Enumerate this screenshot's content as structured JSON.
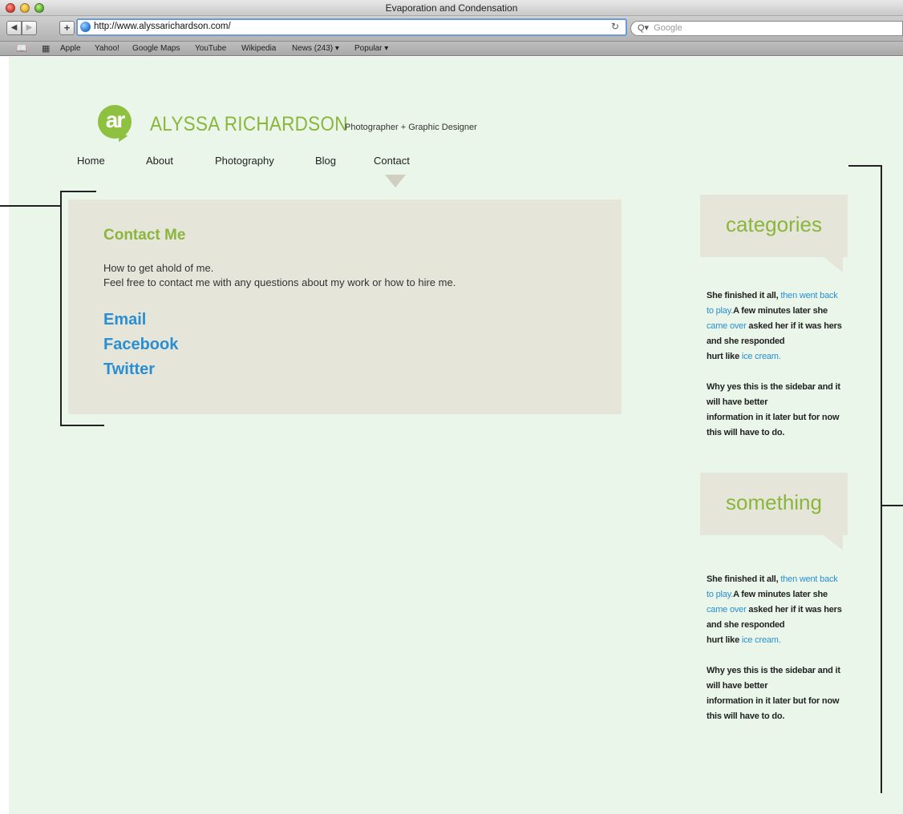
{
  "window": {
    "title": "Evaporation and Condensation"
  },
  "toolbar": {
    "back_icon": "◀",
    "forward_icon": "▶",
    "add_icon": "+",
    "url": "http://www.alyssarichardson.com/",
    "reload_icon": "↻",
    "search_icon": "Q▾",
    "search_placeholder": "Google"
  },
  "bookmarks": {
    "items": [
      "Apple",
      "Yahoo!",
      "Google Maps",
      "YouTube",
      "Wikipedia",
      "News (243) ▾",
      "Popular ▾"
    ]
  },
  "site": {
    "logo_text": "ar",
    "name": "ALYSSA RICHARDSON",
    "tagline": "Photographer + Graphic Designer",
    "nav": [
      "Home",
      "About",
      "Photography",
      "Blog",
      "Contact"
    ],
    "active_nav": "Contact"
  },
  "contact": {
    "title": "Contact Me",
    "line1": "How to get ahold of me.",
    "line2": "Feel free to contact me with any questions about my work or how to hire me.",
    "links": [
      "Email",
      "Facebook",
      "Twitter"
    ]
  },
  "sidebar": {
    "sections": [
      {
        "heading": "categories",
        "p1_a": "She finished it all,",
        "p1_link1": "then went back",
        "p1_b": "to play.",
        "p1_c": "A few minutes later she",
        "p1_link2": "came over",
        "p1_d": "asked her if it was hers",
        "p1_e": "and she responded",
        "p1_f": "hurt like",
        "p1_link3": "ice cream.",
        "p2_1": "Why yes this is the sidebar and it",
        "p2_2": "will have better",
        "p2_3": "information in it later but for now",
        "p2_4": "this will have to do."
      },
      {
        "heading": "something",
        "p1_a": "She finished it all,",
        "p1_link1": "then went back",
        "p1_b": "to play.",
        "p1_c": "A few minutes later she",
        "p1_link2": "came over",
        "p1_d": "asked her if it was hers",
        "p1_e": "and she responded",
        "p1_f": "hurt like",
        "p1_link3": "ice cream.",
        "p2_1": "Why yes this is the sidebar and it",
        "p2_2": "will have better",
        "p2_3": "information in it later but for now",
        "p2_4": "this will have to do."
      }
    ]
  },
  "colors": {
    "page_background": "#eaf6ea",
    "accent_green": "#8ab63c",
    "link_blue": "#2a8ed0",
    "box_beige": "#e5e5da"
  }
}
